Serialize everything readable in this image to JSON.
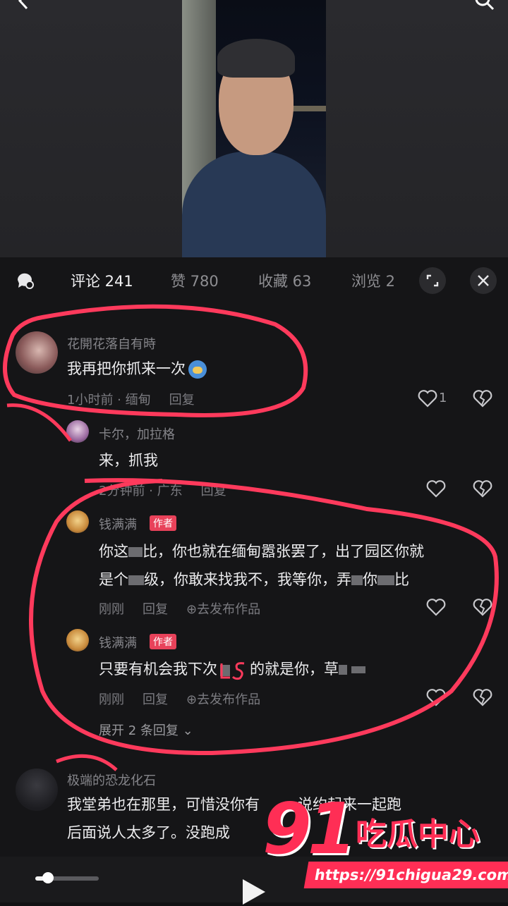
{
  "tabs": {
    "comments": "评论 241",
    "likes": "赞 780",
    "favorites": "收藏 63",
    "views": "浏览 2"
  },
  "comments": [
    {
      "author": "花開花落自有時",
      "text": "我再把你抓来一次",
      "time": "1小时前 · 缅甸",
      "reply": "回复",
      "likes": "1"
    },
    {
      "author": "卡尔，加拉格",
      "text": "来，抓我",
      "time": "2分钟前 · 广东",
      "reply": "回复"
    },
    {
      "author": "钱满满",
      "badge": "作者",
      "text_line1": "你这",
      "text_line1b": "比，你也就在缅甸嚣张罢了，出了园区你就",
      "text_line2a": "是个",
      "text_line2b": "级，你敢来找我不，我等你，弄",
      "text_line2c": "你",
      "text_line2d": "比",
      "time": "刚刚",
      "reply": "回复",
      "publish": "去发布作品"
    },
    {
      "author": "钱满满",
      "badge": "作者",
      "text_a": "只要有机会我下次",
      "text_b": "的就是你，草",
      "time": "刚刚",
      "reply": "回复",
      "publish": "去发布作品"
    }
  ],
  "expand_replies": "展开 2 条回复",
  "last_comment": {
    "author": "极端的恐龙化石",
    "line1": "我堂弟也在那里，可惜没你有",
    "line1b": "说约起来一起跑",
    "line2": "后面说人太多了。没跑成"
  },
  "watermark": {
    "number": "91",
    "title": "吃瓜中心",
    "url": "https://91chigua29.com"
  },
  "colors": {
    "accent": "#e8425a",
    "annotation": "#ff3a5c"
  },
  "progress": 0.08
}
